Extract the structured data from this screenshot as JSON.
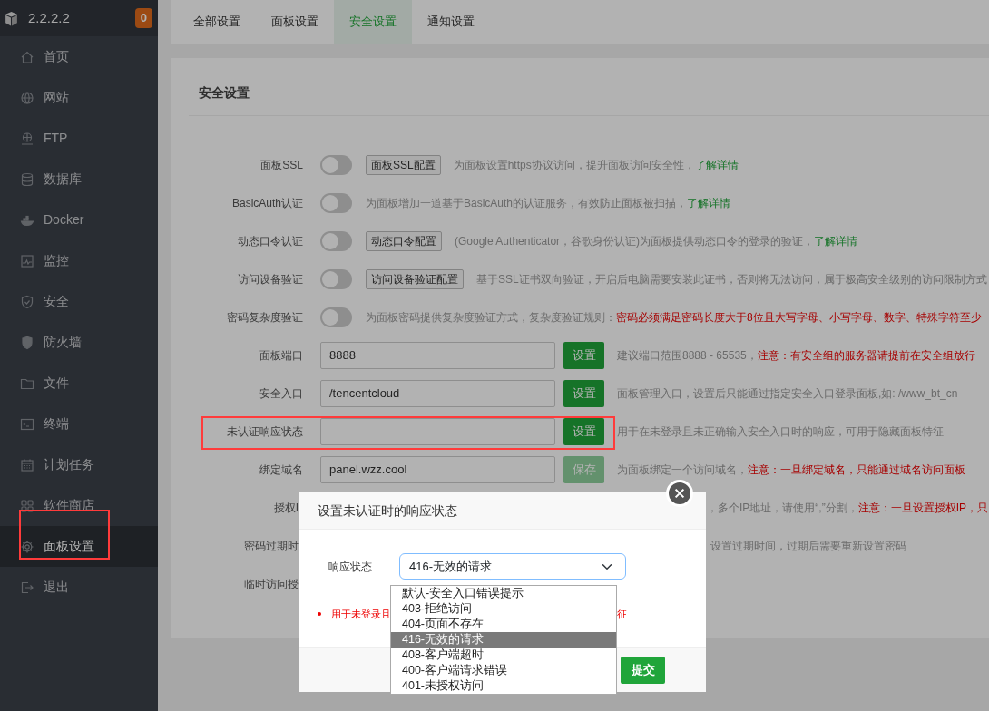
{
  "sidebar": {
    "server": "2.2.2.2",
    "badge": "0",
    "items": [
      {
        "label": "首页",
        "selected": false,
        "highlighted": false
      },
      {
        "label": "网站",
        "selected": false,
        "highlighted": false
      },
      {
        "label": "FTP",
        "selected": false,
        "highlighted": false
      },
      {
        "label": "数据库",
        "selected": false,
        "highlighted": false
      },
      {
        "label": "Docker",
        "selected": false,
        "highlighted": false
      },
      {
        "label": "监控",
        "selected": false,
        "highlighted": false
      },
      {
        "label": "安全",
        "selected": false,
        "highlighted": false
      },
      {
        "label": "防火墙",
        "selected": false,
        "highlighted": false
      },
      {
        "label": "文件",
        "selected": false,
        "highlighted": false
      },
      {
        "label": "终端",
        "selected": false,
        "highlighted": false
      },
      {
        "label": "计划任务",
        "selected": false,
        "highlighted": false
      },
      {
        "label": "软件商店",
        "selected": false,
        "highlighted": false
      },
      {
        "label": "面板设置",
        "selected": true,
        "highlighted": true
      },
      {
        "label": "退出",
        "selected": false,
        "highlighted": false
      }
    ]
  },
  "tabs": [
    {
      "label": "全部设置",
      "selected": false
    },
    {
      "label": "面板设置",
      "selected": false
    },
    {
      "label": "安全设置",
      "selected": true
    },
    {
      "label": "通知设置",
      "selected": false
    }
  ],
  "panel": {
    "title": "安全设置",
    "rows": [
      {
        "kind": "toggle",
        "label": "面板SSL",
        "on": false,
        "button": "面板SSL配置",
        "highlighted": false,
        "description": [
          {
            "kind": "normal",
            "text": "为面板设置https协议访问，提升面板访问安全性，"
          },
          {
            "kind": "link",
            "text": "了解详情"
          }
        ]
      },
      {
        "kind": "toggle",
        "label": "BasicAuth认证",
        "on": false,
        "highlighted": false,
        "description": [
          {
            "kind": "normal",
            "text": "为面板增加一道基于BasicAuth的认证服务，有效防止面板被扫描，"
          },
          {
            "kind": "link",
            "text": "了解详情"
          }
        ]
      },
      {
        "kind": "toggle",
        "label": "动态口令认证",
        "on": false,
        "button": "动态口令配置",
        "highlighted": false,
        "description": [
          {
            "kind": "normal",
            "text": "(Google Authenticator，谷歌身份认证)为面板提供动态口令的登录的验证，"
          },
          {
            "kind": "link",
            "text": "了解详情"
          }
        ]
      },
      {
        "kind": "toggle",
        "label": "访问设备验证",
        "on": false,
        "button": "访问设备验证配置",
        "highlighted": false,
        "description": [
          {
            "kind": "normal",
            "text": "基于SSL证书双向验证，开启后电脑需要安装此证书，否则将无法访问，属于极高安全级别的访问限制方式"
          }
        ]
      },
      {
        "kind": "toggle",
        "label": "密码复杂度验证",
        "on": false,
        "highlighted": false,
        "description": [
          {
            "kind": "normal",
            "text": "为面板密码提供复杂度验证方式，复杂度验证规则："
          },
          {
            "kind": "warn",
            "text": "密码必须满足密码长度大于8位且大写字母、小写字母、数字、特殊字符至少"
          }
        ]
      },
      {
        "kind": "input",
        "label": "面板端口",
        "value": "8888",
        "button": "设置",
        "disabled": false,
        "highlighted": false,
        "description": [
          {
            "kind": "normal",
            "text": "建议端口范围8888 - 65535，"
          },
          {
            "kind": "warn",
            "text": "注意：有安全组的服务器请提前在安全组放行"
          }
        ]
      },
      {
        "kind": "input",
        "label": "安全入口",
        "value": "/tencentcloud",
        "button": "设置",
        "disabled": false,
        "highlighted": false,
        "description": [
          {
            "kind": "normal",
            "text": "面板管理入口，设置后只能通过指定安全入口登录面板,如: /www_bt_cn"
          }
        ]
      },
      {
        "kind": "input",
        "label": "未认证响应状态",
        "button": "设置",
        "disabled": false,
        "highlighted": true,
        "description": [
          {
            "kind": "normal",
            "text": "用于在未登录且未正确输入安全入口时的响应，可用于隐藏面板特征"
          }
        ]
      },
      {
        "kind": "input",
        "label": "绑定域名",
        "value": "panel.wzz.cool",
        "button": "保存",
        "disabled": true,
        "highlighted": false,
        "description": [
          {
            "kind": "normal",
            "text": "为面板绑定一个访问域名，"
          },
          {
            "kind": "warn",
            "text": "注意：一旦绑定域名，只能通过域名访问面板"
          }
        ]
      },
      {
        "kind": "input",
        "label": "授权I",
        "highlighted": false,
        "description": [
          {
            "kind": "normal",
            "text": "，多个IP地址，请使用“,”分割，"
          },
          {
            "kind": "warn",
            "text": "注意：一旦设置授权IP，只"
          }
        ]
      },
      {
        "kind": "plain",
        "label": "密码过期时",
        "highlighted": false,
        "description": [
          {
            "kind": "normal",
            "text": "设置过期时间，过期后需要重新设置密码"
          }
        ]
      },
      {
        "kind": "plain",
        "label": "临时访问授",
        "highlighted": false
      }
    ]
  },
  "dialog": {
    "title": "设置未认证时的响应状态",
    "field_label": "响应状态",
    "value": "416-无效的请求",
    "note_start": "用于未登录且",
    "note_end": "征",
    "submit": "提交",
    "options": [
      {
        "label": "默认-安全入口错误提示",
        "selected": false
      },
      {
        "label": "403-拒绝访问",
        "selected": false
      },
      {
        "label": "404-页面不存在",
        "selected": false
      },
      {
        "label": "416-无效的请求",
        "selected": true
      },
      {
        "label": "408-客户端超时",
        "selected": false
      },
      {
        "label": "400-客户端请求错误",
        "selected": false
      },
      {
        "label": "401-未授权访问",
        "selected": false
      }
    ]
  }
}
